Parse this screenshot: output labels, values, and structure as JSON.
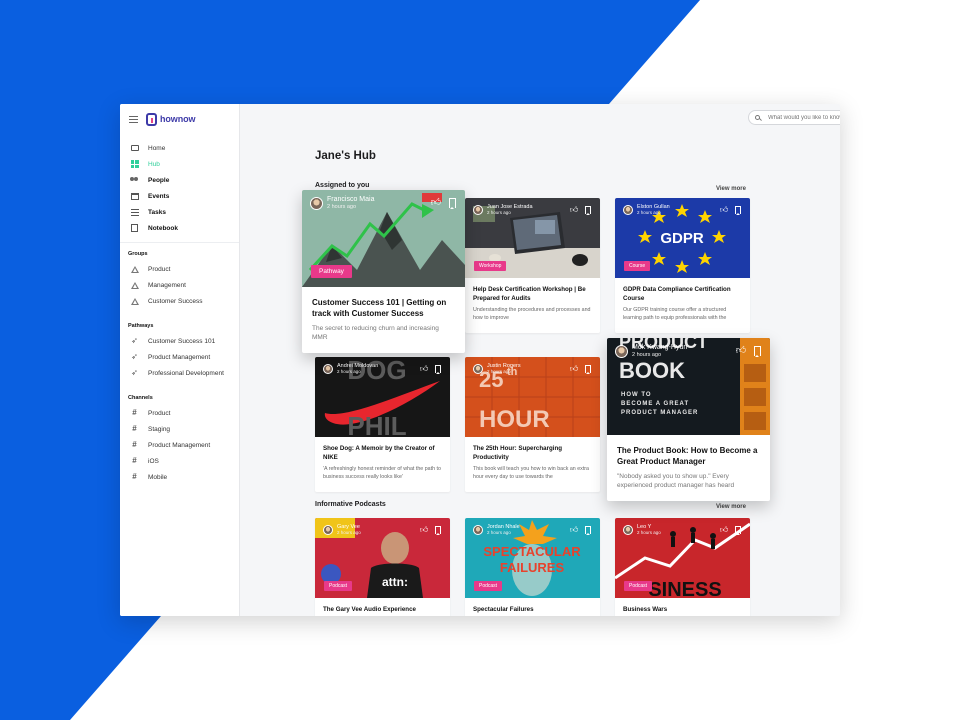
{
  "app": {
    "logo_text": "hownow"
  },
  "sidebar": {
    "main_items": [
      {
        "label": "Home",
        "icon": "monitor-icon"
      },
      {
        "label": "Hub",
        "icon": "grid-icon"
      },
      {
        "label": "People",
        "icon": "people-icon"
      },
      {
        "label": "Events",
        "icon": "calendar-icon"
      },
      {
        "label": "Tasks",
        "icon": "tasks-icon"
      },
      {
        "label": "Notebook",
        "icon": "notebook-icon"
      }
    ],
    "groups_title": "Groups",
    "groups": [
      "Product",
      "Management",
      "Customer Success"
    ],
    "pathways_title": "Pathways",
    "pathways": [
      "Customer Success 101",
      "Product Management",
      "Professional Development"
    ],
    "channels_title": "Channels",
    "channels": [
      "Product",
      "Staging",
      "Product Management",
      "iOS",
      "Mobile"
    ]
  },
  "topbar": {
    "search_placeholder": "What would you like to know?"
  },
  "main": {
    "title": "Jane's Hub",
    "assigned_title": "Assigned to you",
    "assigned_view_more": "View more",
    "podcasts_title": "Informative Podcasts",
    "podcasts_view_more": "View more",
    "assigned_cards": [
      {
        "author": "Francisco Maia",
        "time": "2 hours ago",
        "tag": "Pathway",
        "title": "Customer Success 101 | Getting on track with Customer Success",
        "desc": "The secret to reducing churn and increasing MMR"
      },
      {
        "author": "Juan Jose Estrada",
        "time": "2 hours ago",
        "tag": "Workshop",
        "title": "Help Desk Certification Workshop | Be Prepared for Audits",
        "desc": "Understanding the procedures and processes and how to improve"
      },
      {
        "author": "Elston Gullan",
        "time": "2 hours ago",
        "tag": "Course",
        "title": "GDPR Data Compliance Certification Course",
        "desc": "Our GDPR training course offer a structured learning path to equip professionals with the"
      },
      {
        "author": "Andrei Moldovan",
        "time": "2 hours ago",
        "tag": "",
        "title": "Shoe Dog: A Memoir by the Creator of NIKE",
        "desc": "'A refreshingly honest reminder of what the path to business success really looks like'"
      },
      {
        "author": "Justin Rogers",
        "time": "2 hours ago",
        "tag": "",
        "title": "The 25th Hour: Supercharging Productivity",
        "desc": "This book will teach you how to win back an extra hour every day to use towards the"
      },
      {
        "author": "Mok Kwang-Hyun",
        "time": "2 hours ago",
        "tag": "",
        "title": "The Product Book: How to Become a Great Product Manager",
        "desc": "\"Nobody asked you to show up.\" Every experienced product manager has heard"
      }
    ],
    "podcast_cards": [
      {
        "author": "Gary Vee",
        "time": "2 hours ago",
        "tag": "Podcast",
        "title": "The Gary Vee Audio Experience"
      },
      {
        "author": "Jordan Nhale",
        "time": "2 hours ago",
        "tag": "Podcast",
        "title": "Spectacular Failures"
      },
      {
        "author": "Leo Y",
        "time": "2 hours ago",
        "tag": "Podcast",
        "title": "Business Wars"
      }
    ]
  },
  "thumbs": {
    "shoe_dog_top": "DOG",
    "shoe_dog_bottom": "PHIL",
    "hour_top": "25",
    "hour_sup": "th",
    "hour_bottom": "HOUR",
    "gdpr": "GDPR",
    "product_book_1": "PRODUCT",
    "product_book_2": "BOOK",
    "product_book_3": "HOW TO",
    "product_book_4": "BECOME A GREAT",
    "product_book_5": "PRODUCT MANAGER",
    "garyvee_shirt": "attn:",
    "spectacular_1": "SPECTACULAR",
    "spectacular_2": "FAILURES",
    "business_wars": "SINESS"
  },
  "colors": {
    "brand_blue": "#0a5fe0",
    "accent_green": "#2fcf9a",
    "tag_pink": "#e8398a",
    "logo_indigo": "#3d3aa8"
  }
}
